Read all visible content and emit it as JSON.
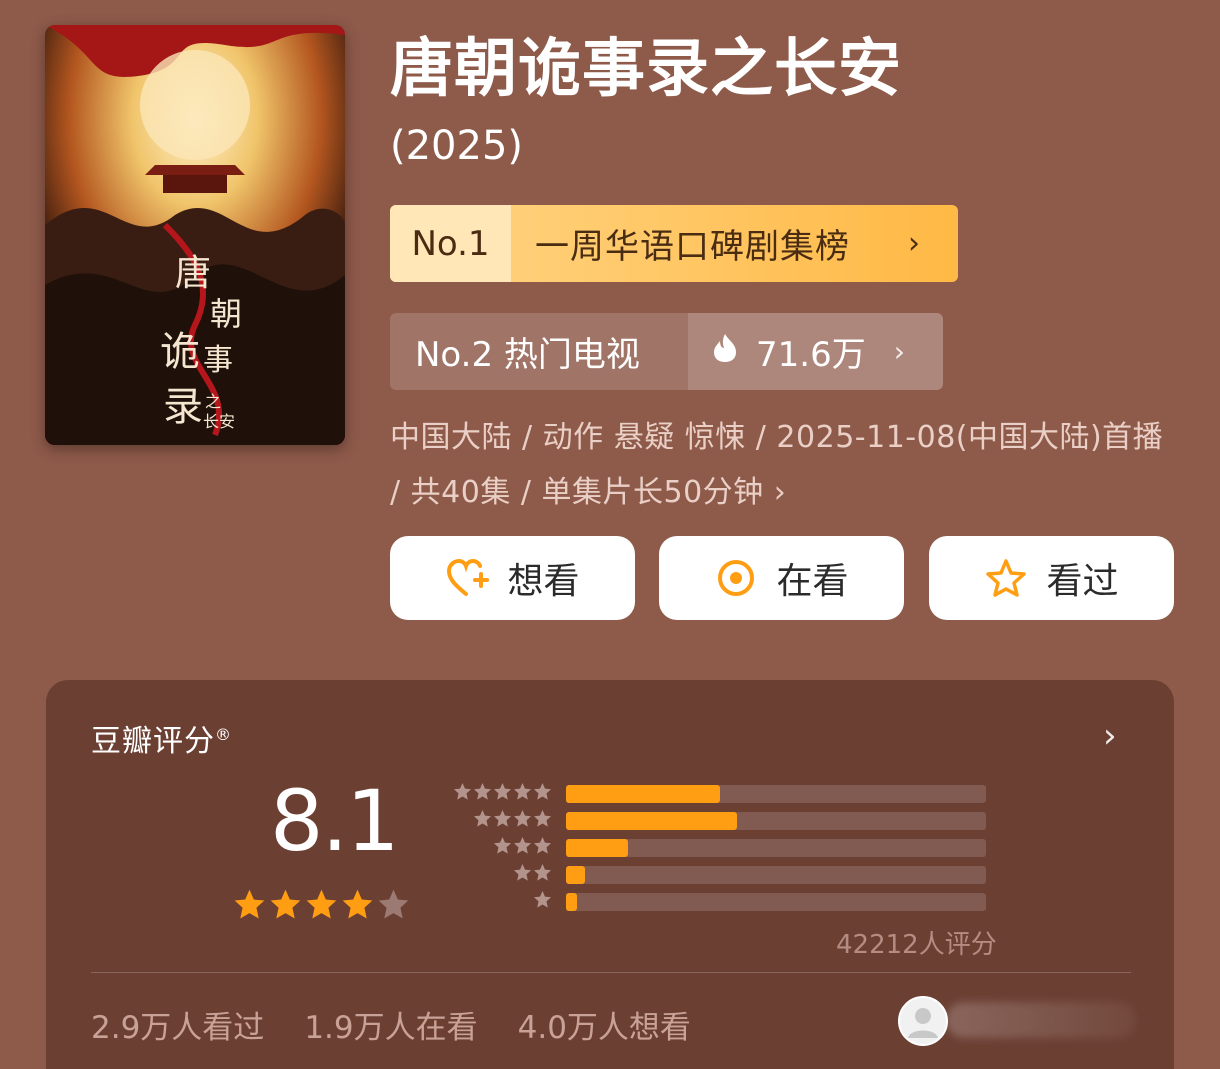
{
  "show": {
    "title": "唐朝诡事录之长安",
    "year": "(2025)",
    "poster_text": "唐朝诡事录之长安"
  },
  "ranks": {
    "first": {
      "no": "No.1",
      "label": "一周华语口碑剧集榜",
      "chevron": "›"
    },
    "second": {
      "label": "No.2 热门电视",
      "hot": "71.6万",
      "chevron": "›"
    }
  },
  "meta": {
    "line": "中国大陆 / 动作 悬疑 惊悚 / 2025-11-08(中国大陆)首播 / 共40集 / 单集片长50分钟 ›"
  },
  "actions": [
    {
      "label": "想看",
      "icon": "heart-plus-icon"
    },
    {
      "label": "在看",
      "icon": "target-icon"
    },
    {
      "label": "看过",
      "icon": "star-outline-icon"
    }
  ],
  "rating": {
    "title": "豆瓣评分",
    "mark": "®",
    "chevron": "›",
    "score": "8.1",
    "stars_filled": 4,
    "stars_total": 5,
    "distribution": [
      {
        "stars": 5,
        "fraction": 0.367
      },
      {
        "stars": 4,
        "fraction": 0.407
      },
      {
        "stars": 3,
        "fraction": 0.148
      },
      {
        "stars": 2,
        "fraction": 0.045
      },
      {
        "stars": 1,
        "fraction": 0.025
      }
    ],
    "count": "42212人评分"
  },
  "stats": {
    "watched": "2.9万人看过",
    "watching": "1.9万人在看",
    "want": "4.0万人想看"
  },
  "colors": {
    "background": "#8e5a4a",
    "panel": "#6c3f33",
    "accent": "#ff9e12",
    "rank1_bg": "#ffb945"
  }
}
